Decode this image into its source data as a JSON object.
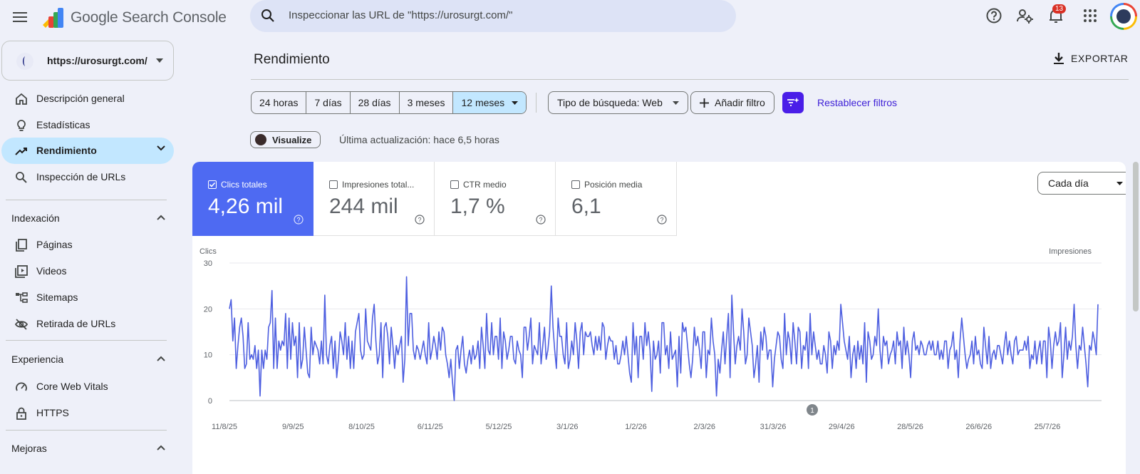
{
  "header": {
    "app_title": "Google Search Console",
    "search_placeholder": "Inspeccionar las URL de \"https://urosurgt.com/\"",
    "notifications_count": "13"
  },
  "sidebar": {
    "property": "https://urosurgt.com/",
    "items": [
      {
        "label": "Descripción general",
        "icon": "home-icon"
      },
      {
        "label": "Estadísticas",
        "icon": "lightbulb-icon"
      },
      {
        "label": "Rendimiento",
        "icon": "trending-up-icon",
        "active": true
      },
      {
        "label": "Inspección de URLs",
        "icon": "search-icon"
      }
    ],
    "sections": [
      {
        "title": "Indexación",
        "items": [
          {
            "label": "Páginas",
            "icon": "pages-icon"
          },
          {
            "label": "Videos",
            "icon": "video-icon"
          },
          {
            "label": "Sitemaps",
            "icon": "sitemap-icon"
          },
          {
            "label": "Retirada de URLs",
            "icon": "eye-off-icon"
          }
        ]
      },
      {
        "title": "Experiencia",
        "items": [
          {
            "label": "Core Web Vitals",
            "icon": "gauge-icon"
          },
          {
            "label": "HTTPS",
            "icon": "lock-icon"
          }
        ]
      },
      {
        "title": "Mejoras",
        "items": []
      }
    ]
  },
  "main": {
    "title": "Rendimiento",
    "export_label": "EXPORTAR",
    "ranges": [
      "24 horas",
      "7 días",
      "28 días",
      "3 meses",
      "12 meses"
    ],
    "selected_range": "12 meses",
    "search_type": "Tipo de búsqueda: Web",
    "add_filter": "Añadir filtro",
    "reset_filters": "Restablecer filtros",
    "visualize": "Visualize",
    "last_update": "Última actualización: hace 6,5 horas",
    "granularity": "Cada día"
  },
  "metrics": [
    {
      "label": "Clics totales",
      "value": "4,26 mil",
      "checked": true,
      "color": "#4e6af2"
    },
    {
      "label": "Impresiones total...",
      "value": "244 mil",
      "checked": false
    },
    {
      "label": "CTR medio",
      "value": "1,7 %",
      "checked": false
    },
    {
      "label": "Posición media",
      "value": "6,1",
      "checked": false
    }
  ],
  "chart_data": {
    "type": "line",
    "left_axis_title": "Clics",
    "right_axis_title": "Impresiones",
    "y_ticks": [
      0,
      10,
      20,
      30
    ],
    "ylim": [
      0,
      30
    ],
    "x_ticks": [
      "11/8/25",
      "9/9/25",
      "8/10/25",
      "6/11/25",
      "5/12/25",
      "3/1/26",
      "1/2/26",
      "2/3/26",
      "31/3/26",
      "29/4/26",
      "28/5/26",
      "26/6/26",
      "25/7/26"
    ],
    "annotation": "1",
    "series": [
      {
        "color": "#4e5fe0",
        "values": [
          20,
          22,
          13,
          18,
          7,
          12,
          16,
          18,
          14,
          7,
          8,
          17,
          9,
          10,
          9,
          12,
          7,
          11,
          1,
          11,
          7,
          11,
          9,
          16,
          17,
          24,
          7,
          18,
          7,
          13,
          11,
          13,
          12,
          19,
          7,
          18,
          9,
          17,
          12,
          14,
          5,
          17,
          7,
          9,
          16,
          11,
          6,
          5,
          16,
          10,
          13,
          12,
          11,
          8,
          13,
          8,
          23,
          10,
          8,
          12,
          14,
          7,
          13,
          5,
          9,
          15,
          13,
          10,
          17,
          9,
          14,
          7,
          13,
          7,
          15,
          17,
          19,
          11,
          9,
          10,
          20,
          13,
          12,
          11,
          18,
          21,
          13,
          8,
          10,
          17,
          5,
          16,
          17,
          14,
          8,
          16,
          12,
          7,
          12,
          10,
          12,
          14,
          4,
          9,
          27,
          12,
          19,
          19,
          11,
          9,
          12,
          11,
          9,
          11,
          13,
          10,
          8,
          17,
          9,
          11,
          14,
          12,
          9,
          15,
          11,
          16,
          15,
          10,
          8,
          5,
          9,
          4,
          0,
          11,
          12,
          7,
          11,
          14,
          8,
          6,
          9,
          11,
          8,
          12,
          9,
          10,
          13,
          7,
          16,
          12,
          7,
          19,
          11,
          10,
          17,
          10,
          14,
          14,
          9,
          18,
          7,
          15,
          13,
          9,
          11,
          14,
          14,
          9,
          8,
          13,
          11,
          10,
          5,
          16,
          16,
          11,
          14,
          18,
          8,
          12,
          11,
          10,
          17,
          8,
          12,
          16,
          9,
          11,
          15,
          25,
          16,
          11,
          7,
          18,
          14,
          14,
          10,
          8,
          17,
          7,
          9,
          13,
          10,
          17,
          13,
          7,
          15,
          17,
          10,
          15,
          14,
          14,
          15,
          12,
          10,
          14,
          11,
          14,
          11,
          17,
          16,
          9,
          12,
          14,
          13,
          13,
          9,
          12,
          8,
          8,
          10,
          13,
          10,
          14,
          10,
          6,
          4,
          17,
          10,
          14,
          5,
          14,
          14,
          9,
          17,
          12,
          15,
          11,
          2,
          13,
          9,
          10,
          13,
          6,
          17,
          17,
          10,
          12,
          7,
          15,
          9,
          10,
          11,
          3,
          14,
          6,
          17,
          15,
          16,
          12,
          8,
          5,
          9,
          16,
          12,
          14,
          11,
          7,
          15,
          15,
          5,
          11,
          10,
          18,
          13,
          10,
          1,
          9,
          6,
          11,
          15,
          8,
          14,
          19,
          5,
          23,
          15,
          8,
          12,
          14,
          11,
          20,
          15,
          8,
          10,
          18,
          15,
          12,
          5,
          8,
          12,
          4,
          15,
          11,
          16,
          14,
          9,
          11,
          11,
          3,
          9,
          12,
          15,
          14,
          9,
          7,
          19,
          10,
          15,
          13,
          8,
          17,
          13,
          8,
          16,
          15,
          7,
          12,
          11,
          15,
          7,
          19,
          10,
          15,
          12,
          9,
          11,
          8,
          8,
          12,
          10,
          6,
          15,
          13,
          7,
          12,
          10,
          13,
          11,
          21,
          17,
          13,
          11,
          9,
          14,
          5,
          10,
          12,
          7,
          13,
          9,
          12,
          8,
          17,
          4,
          15,
          13,
          9,
          10,
          14,
          12,
          20,
          11,
          7,
          14,
          12,
          13,
          8,
          10,
          11,
          13,
          8,
          15,
          12,
          13,
          7,
          16,
          10,
          13,
          10,
          5,
          13,
          15,
          11,
          12,
          10,
          13,
          12,
          10,
          10,
          12,
          13,
          11,
          13,
          10,
          10,
          13,
          9,
          11,
          9,
          13,
          13,
          7,
          11,
          12,
          15,
          9,
          11,
          5,
          13,
          18,
          14,
          10,
          7,
          9,
          10,
          13,
          8,
          14,
          10,
          11,
          8,
          7,
          16,
          12,
          8,
          14,
          7,
          10,
          11,
          9,
          12,
          12,
          10,
          8,
          12,
          15,
          10,
          13,
          10,
          8,
          13,
          14,
          10,
          11,
          11,
          11,
          13,
          11,
          14,
          7,
          10,
          9,
          13,
          8,
          11,
          13,
          8,
          13,
          13,
          5,
          16,
          13,
          7,
          12,
          15,
          12,
          13,
          17,
          5,
          10,
          16,
          9,
          13,
          11,
          14,
          21,
          12,
          7,
          12,
          11,
          16,
          12,
          8,
          3,
          12,
          11,
          15,
          13,
          10,
          21
        ]
      }
    ]
  }
}
